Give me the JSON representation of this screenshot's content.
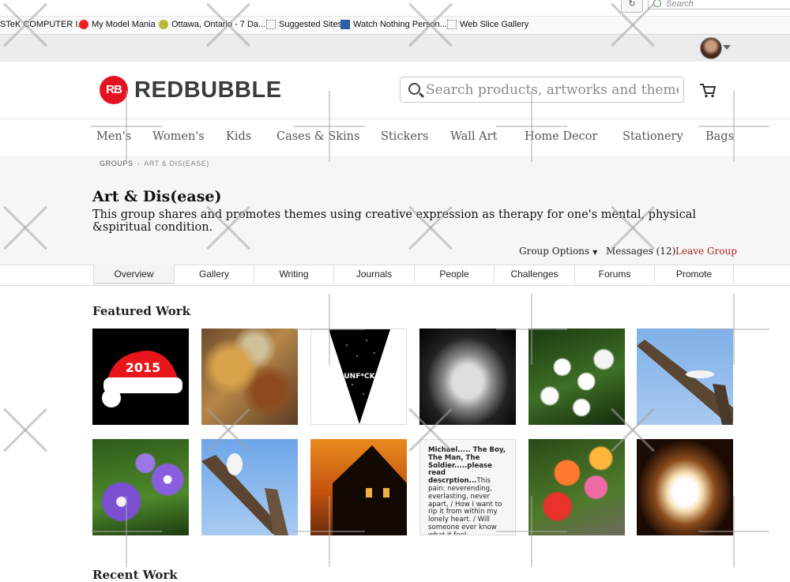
{
  "browser": {
    "search_placeholder": "Search",
    "favorites": [
      {
        "label": "STeK COMPUTER I...",
        "icon": "none"
      },
      {
        "label": "My Model Mania",
        "icon": "redbubble-icon"
      },
      {
        "label": "Ottawa, Ontario - 7 Da...",
        "icon": "weather-icon"
      },
      {
        "label": "Suggested Sites",
        "icon": "web-slice-icon"
      },
      {
        "label": "Watch Nothing Person...",
        "icon": "tv-icon"
      },
      {
        "label": "Web Slice Gallery",
        "icon": "web-slice-icon"
      }
    ]
  },
  "site": {
    "logo_badge": "RB",
    "logo_text": "REDBUBBLE",
    "search_placeholder": "Search products, artworks and themes"
  },
  "categories": [
    "Men's",
    "Women's",
    "Kids",
    "Cases & Skins",
    "Stickers",
    "Wall Art",
    "Home Decor",
    "Stationery",
    "Bags"
  ],
  "breadcrumb": {
    "root": "GROUPS",
    "separator": "›",
    "current": "ART & DIS(EASE)"
  },
  "group": {
    "title": "Art & Dis(ease)",
    "description": "This group shares and promotes themes using creative expression as therapy for one's mental, physical &spiritual condition.",
    "options_label": "Group Options",
    "messages_label": "Messages (12)",
    "leave_label": "Leave Group"
  },
  "tabs": [
    "Overview",
    "Gallery",
    "Writing",
    "Journals",
    "People",
    "Challenges",
    "Forums",
    "Promote"
  ],
  "active_tab": "Overview",
  "featured": {
    "title": "Featured Work",
    "text_excerpt": {
      "title": "Michael..... The Boy, The Man, The Soldier.....please read descrption...",
      "body": "This pain: neverending, everlasting, never apart, / How I want to rip it from within my lonely heart. / Will someone ever know what it feel..."
    },
    "unfck_text": "UNF*CK"
  },
  "recent": {
    "title": "Recent Work"
  },
  "colors": {
    "brand": "#e41321",
    "leave_link": "#aa2222",
    "page_bg": "#f6f6f6"
  }
}
